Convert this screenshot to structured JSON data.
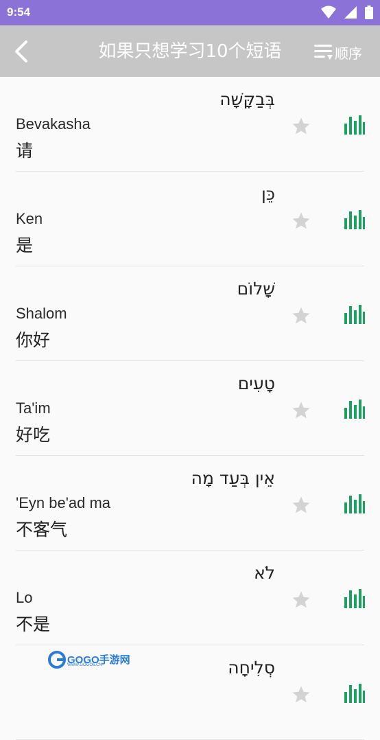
{
  "status_bar": {
    "time": "9:54",
    "icons": [
      "wifi-icon",
      "signal-icon",
      "battery-icon"
    ]
  },
  "app_bar": {
    "title": "如果只想学习10个短语",
    "sort_label": "顺序"
  },
  "colors": {
    "status_bar": "#8a72d6",
    "app_bar": "#c6c6c6",
    "audio_icon": "#1aa160",
    "star_icon": "#d3d3d3"
  },
  "phrases": [
    {
      "hebrew": "בְּבַקָּשָׁה",
      "translit": "Bevakasha",
      "meaning": "请"
    },
    {
      "hebrew": "כֵּן",
      "translit": "Ken",
      "meaning": "是"
    },
    {
      "hebrew": "שָׁלוֹם",
      "translit": "Shalom",
      "meaning": "你好"
    },
    {
      "hebrew": "טָעִים",
      "translit": "Ta'im",
      "meaning": "好吃"
    },
    {
      "hebrew": "אֵין בְּעַד מָה",
      "translit": "'Eyn be'ad ma",
      "meaning": "不客气"
    },
    {
      "hebrew": "לֹא",
      "translit": "Lo",
      "meaning": "不是"
    },
    {
      "hebrew": "סְלִיחָה",
      "translit": "",
      "meaning": ""
    }
  ],
  "watermark": {
    "text": "GOGO手游网",
    "sub": "WWW.GOGO6.CN"
  }
}
